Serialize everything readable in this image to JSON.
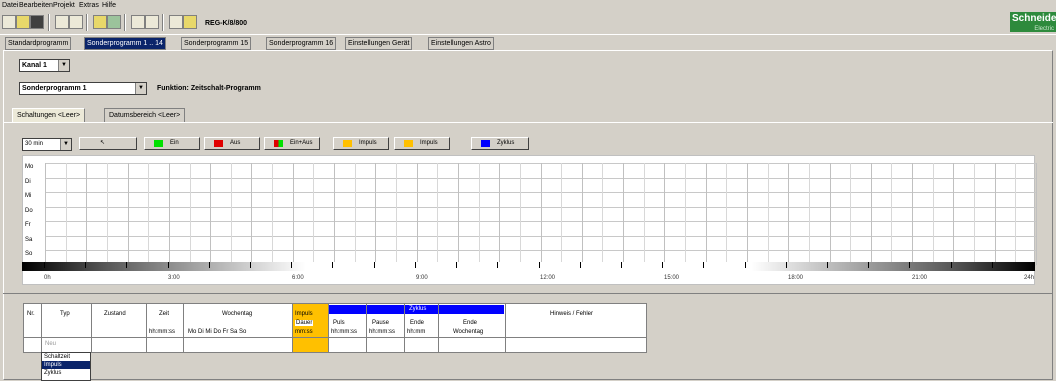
{
  "menu": {
    "items": [
      "Datei",
      "Bearbeiten",
      "Projekt",
      "Extras",
      "Hilfe"
    ]
  },
  "toolbar": {
    "device_label": "REG-K/8/800"
  },
  "logo": {
    "main": "Schneider",
    "sub": "Electric"
  },
  "tabs": [
    "Standardprogramm",
    "Sonderprogramm 1 .. 14",
    "Sonderprogramm 15",
    "Sonderprogramm 16",
    "Einstellungen Gerät",
    "Einstellungen Astro"
  ],
  "active_tab_index": 1,
  "kanal": {
    "value": "Kanal 1"
  },
  "programm": {
    "value": "Sonderprogramm 1"
  },
  "funktion": "Funktion: Zeitschalt-Programm",
  "subtabs": [
    "Schaltungen <Leer>",
    "Datumsbereich <Leer>"
  ],
  "interval": {
    "value": "30 min"
  },
  "buttons": [
    {
      "label": "Ein",
      "color": "#00e000"
    },
    {
      "label": "Aus",
      "color": "#e00000"
    },
    {
      "label": "Ein+Aus",
      "color": "#e0a000"
    },
    {
      "label": "Impuls",
      "color": "#ffc000"
    },
    {
      "label": "Impuls",
      "color": "#ffc000"
    },
    {
      "label": "Zyklus",
      "color": "#0000ff"
    }
  ],
  "days": [
    "Mo",
    "Di",
    "Mi",
    "Do",
    "Fr",
    "Sa",
    "So"
  ],
  "hours": [
    "0h",
    "3:00",
    "6:00",
    "9:00",
    "12:00",
    "15:00",
    "18:00",
    "21:00",
    "24h"
  ],
  "table": {
    "headers": {
      "nr": "Nr.",
      "typ": "Typ",
      "zustand": "Zustand",
      "zeit": "Zeit",
      "zeit_sub": "hh:mm:ss",
      "wochentag": "Wochentag",
      "wochentag_days": "Mo  Di  Mi  Do  Fr  Sa  So",
      "impuls": "Impuls",
      "dauer": "Dauer",
      "dauer_sub": "mm:ss",
      "zyklus": "Zyklus",
      "puls": "Puls",
      "puls_sub": "hh:mm:ss",
      "pause": "Pause",
      "pause_sub": "hh:mm:ss",
      "ende": "Ende",
      "ende_sub": "hh:mm",
      "ende_wt": "Ende",
      "ende_wt_sub": "Wochentag",
      "hinweis": "Hinweis / Fehler"
    },
    "new_row": "Neu"
  },
  "typ_options": [
    "Schaltzeit",
    "Impuls",
    "Zyklus"
  ],
  "typ_selected_index": 1
}
